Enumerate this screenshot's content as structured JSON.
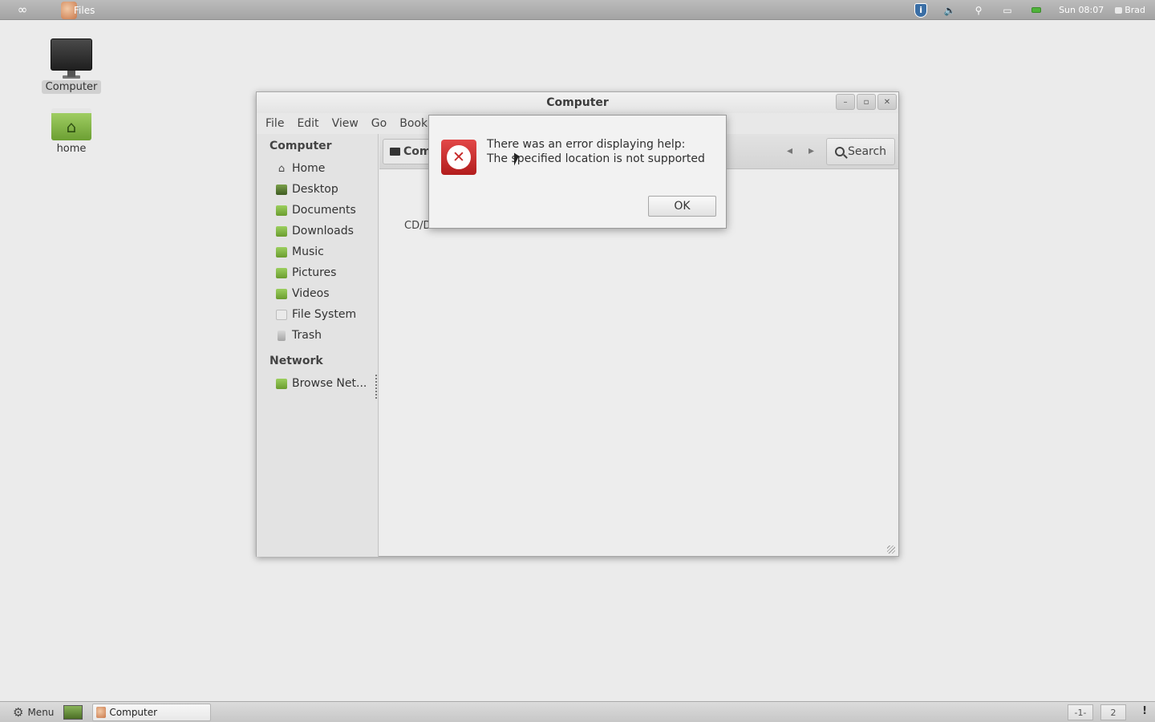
{
  "top_panel": {
    "logo_icon": "infinity-icon",
    "app_label": "Files",
    "clock": "Sun 08:07",
    "user": "Brad"
  },
  "desktop": {
    "icons": [
      {
        "label": "Computer",
        "icon": "monitor-icon"
      },
      {
        "label": "home",
        "icon": "home-folder-icon"
      }
    ]
  },
  "window": {
    "title": "Computer",
    "menu": [
      "File",
      "Edit",
      "View",
      "Go",
      "Book"
    ],
    "sidebar": {
      "computer_header": "Computer",
      "items": [
        "Home",
        "Desktop",
        "Documents",
        "Downloads",
        "Music",
        "Pictures",
        "Videos",
        "File System",
        "Trash"
      ],
      "network_header": "Network",
      "network_items": [
        "Browse Net..."
      ]
    },
    "toolbar": {
      "path_button": "Com",
      "search_label": "Search"
    },
    "content": {
      "drive_label": "CD/D"
    }
  },
  "dialog": {
    "line1": "There was an error displaying help:",
    "line2": "The specified location is not supported",
    "ok_label": "OK"
  },
  "bottom_panel": {
    "menu_label": "Menu",
    "task_label": "Computer",
    "workspace_1": "-1-",
    "workspace_2": "2",
    "notify": "!"
  },
  "colors": {
    "error_red": "#c62828",
    "folder_green": "#7aa83f"
  }
}
